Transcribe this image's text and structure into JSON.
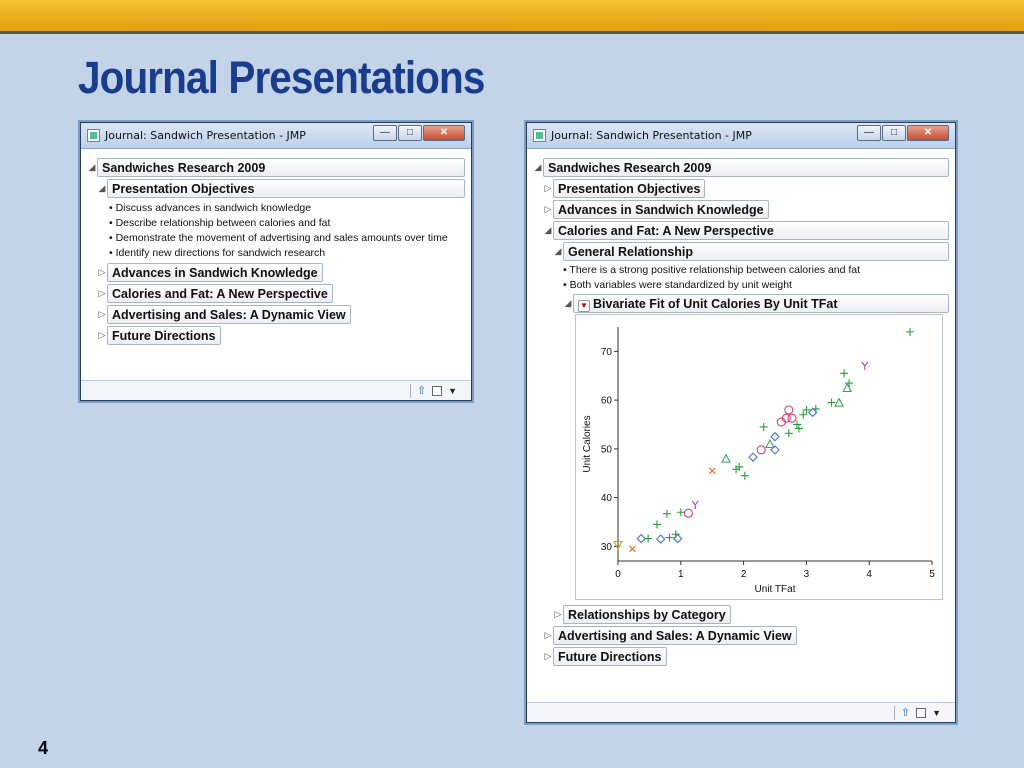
{
  "slide": {
    "title": "Journal Presentations",
    "page_number": "4"
  },
  "window_left": {
    "title": "Journal: Sandwich Presentation - JMP",
    "outline": {
      "root": "Sandwiches Research 2009",
      "objectives": "Presentation Objectives",
      "bullets": [
        "Discuss advances in sandwich knowledge",
        "Describe relationship between calories and fat",
        "Demonstrate the movement of advertising and sales amounts over time",
        "Identify new directions for sandwich research"
      ],
      "advances": "Advances in Sandwich Knowledge",
      "calories": "Calories and Fat: A New Perspective",
      "advertising": "Advertising and Sales: A Dynamic View",
      "future": "Future Directions"
    }
  },
  "window_right": {
    "title": "Journal: Sandwich Presentation - JMP",
    "outline": {
      "root": "Sandwiches Research 2009",
      "objectives": "Presentation Objectives",
      "advances": "Advances in Sandwich Knowledge",
      "calories": "Calories and Fat: A New Perspective",
      "general": "General Relationship",
      "bullets": [
        "There is a strong positive relationship between calories and fat",
        "Both variables were standardized by unit weight"
      ],
      "bivariate": "Bivariate Fit of Unit Calories By Unit TFat",
      "relationships": "Relationships by Category",
      "advertising": "Advertising and Sales: A Dynamic View",
      "future": "Future Directions"
    }
  },
  "icons": {
    "home": "home-icon",
    "checkbox": "checkbox-icon",
    "menu": "dropdown-arrow-icon"
  },
  "colors": {
    "plus": "#2a9d3a",
    "circle": "#d9426e",
    "diamond": "#4a78c8",
    "triangle": "#3aa860",
    "x": "#e07030",
    "y": "#b03cb0",
    "tri_down": "#d4a010"
  },
  "chart_data": {
    "type": "scatter",
    "xlabel": "Unit TFat",
    "ylabel": "Unit Calories",
    "xlim": [
      0,
      5
    ],
    "ylim": [
      27,
      75
    ],
    "xticks": [
      "0",
      "1",
      "2",
      "3",
      "4",
      "5"
    ],
    "yticks": [
      "30",
      "40",
      "50",
      "60",
      "70"
    ],
    "grid": false,
    "points": [
      {
        "x": 0,
        "y": 30.3,
        "m": "tri_down"
      },
      {
        "x": 0.23,
        "y": 29.5,
        "m": "x"
      },
      {
        "x": 0.37,
        "y": 31.6,
        "m": "diamond"
      },
      {
        "x": 0.48,
        "y": 31.6,
        "m": "plus"
      },
      {
        "x": 0.62,
        "y": 34.5,
        "m": "plus"
      },
      {
        "x": 0.68,
        "y": 31.5,
        "m": "diamond"
      },
      {
        "x": 0.78,
        "y": 36.7,
        "m": "plus"
      },
      {
        "x": 0.82,
        "y": 31.8,
        "m": "plus"
      },
      {
        "x": 0.92,
        "y": 32.5,
        "m": "plus"
      },
      {
        "x": 0.95,
        "y": 31.6,
        "m": "diamond"
      },
      {
        "x": 1.0,
        "y": 37.0,
        "m": "plus"
      },
      {
        "x": 1.12,
        "y": 36.8,
        "m": "circle"
      },
      {
        "x": 1.23,
        "y": 38.5,
        "m": "y"
      },
      {
        "x": 1.5,
        "y": 45.5,
        "m": "x"
      },
      {
        "x": 1.72,
        "y": 48.0,
        "m": "triangle"
      },
      {
        "x": 1.88,
        "y": 45.8,
        "m": "plus"
      },
      {
        "x": 1.93,
        "y": 46.3,
        "m": "plus"
      },
      {
        "x": 2.02,
        "y": 44.5,
        "m": "plus"
      },
      {
        "x": 2.15,
        "y": 48.3,
        "m": "diamond"
      },
      {
        "x": 2.28,
        "y": 49.8,
        "m": "circle"
      },
      {
        "x": 2.32,
        "y": 54.5,
        "m": "plus"
      },
      {
        "x": 2.42,
        "y": 51.0,
        "m": "triangle"
      },
      {
        "x": 2.5,
        "y": 49.8,
        "m": "diamond"
      },
      {
        "x": 2.5,
        "y": 52.5,
        "m": "diamond"
      },
      {
        "x": 2.6,
        "y": 55.5,
        "m": "circle"
      },
      {
        "x": 2.68,
        "y": 56.3,
        "m": "circle"
      },
      {
        "x": 2.72,
        "y": 58.0,
        "m": "circle"
      },
      {
        "x": 2.72,
        "y": 53.2,
        "m": "plus"
      },
      {
        "x": 2.77,
        "y": 56.3,
        "m": "circle"
      },
      {
        "x": 2.85,
        "y": 55.0,
        "m": "plus"
      },
      {
        "x": 2.88,
        "y": 54.2,
        "m": "plus"
      },
      {
        "x": 2.95,
        "y": 57.0,
        "m": "plus"
      },
      {
        "x": 3.0,
        "y": 58.0,
        "m": "plus"
      },
      {
        "x": 3.1,
        "y": 57.5,
        "m": "diamond"
      },
      {
        "x": 3.15,
        "y": 58.2,
        "m": "plus"
      },
      {
        "x": 3.4,
        "y": 59.5,
        "m": "plus"
      },
      {
        "x": 3.52,
        "y": 59.5,
        "m": "triangle"
      },
      {
        "x": 3.6,
        "y": 65.5,
        "m": "plus"
      },
      {
        "x": 3.65,
        "y": 62.5,
        "m": "triangle"
      },
      {
        "x": 3.68,
        "y": 63.5,
        "m": "plus"
      },
      {
        "x": 3.93,
        "y": 67.0,
        "m": "y"
      },
      {
        "x": 4.65,
        "y": 74.0,
        "m": "plus"
      }
    ]
  }
}
